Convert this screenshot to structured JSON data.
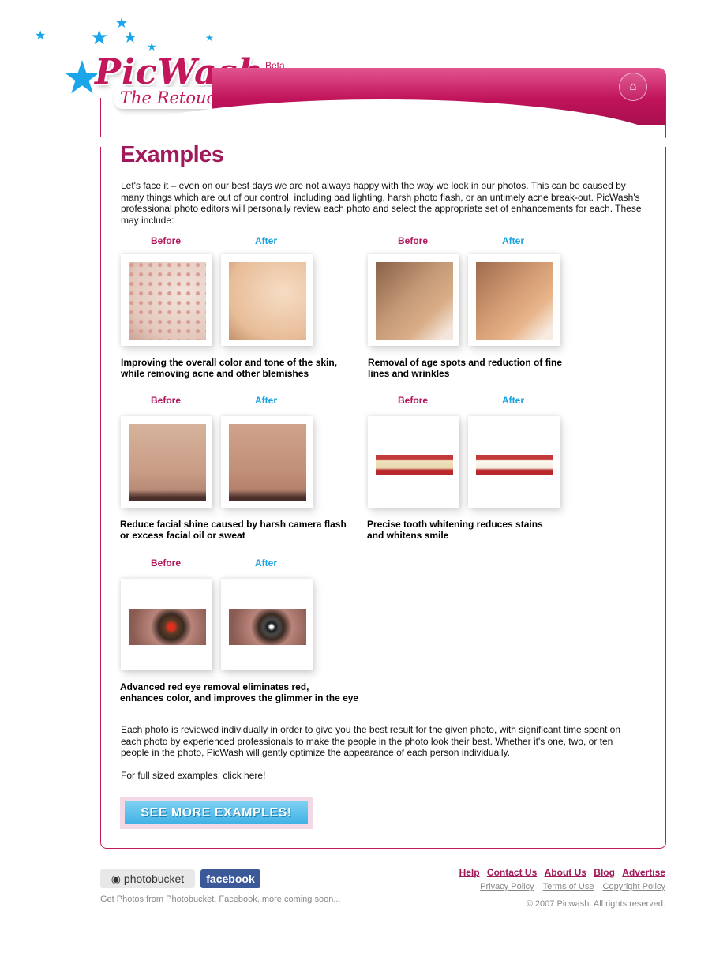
{
  "logo": {
    "name": "PicWash",
    "beta": "Beta",
    "tagline": "The Retouching Revolution"
  },
  "header": {
    "home_icon": "home-icon"
  },
  "page": {
    "title": "Examples",
    "intro": "Let's face it – even on our best days we are not always happy with the way we look in our photos. This can be caused by many things which are out of our control, including bad lighting, harsh photo flash, or an untimely acne break-out. PicWash's professional photo editors will personally review each photo and select the appropriate set of enhancements for each. These may include:",
    "examples": [
      {
        "before": "Before",
        "after": "After",
        "caption_line1": "Improving the overall color and tone of the skin,",
        "caption_line2": "while removing acne and other blemishes"
      },
      {
        "before": "Before",
        "after": "After",
        "caption_line1": "Removal of age spots and reduction of fine",
        "caption_line2": "lines and wrinkles"
      },
      {
        "before": "Before",
        "after": "After",
        "caption_line1": "Reduce facial shine caused by harsh camera flash",
        "caption_line2": "or excess facial oil or sweat"
      },
      {
        "before": "Before",
        "after": "After",
        "caption_line1": "Precise tooth whitening reduces stains",
        "caption_line2": "and whitens smile"
      },
      {
        "before": "Before",
        "after": "After",
        "caption_line1": "Advanced red eye removal eliminates red,",
        "caption_line2": "enhances color, and improves the glimmer in the eye"
      }
    ],
    "outro": "Each photo is reviewed individually in order to give you the best result for the given photo, with significant time spent on each photo by experienced professionals to make the people in the photo look their best. Whether it's one, two, or ten people in the photo, PicWash will gently optimize the appearance of each person individually.",
    "full_examples": "For full sized examples, click here!",
    "see_more": "SEE MORE EXAMPLES!"
  },
  "footer": {
    "photobucket": "photobucket",
    "facebook": "facebook",
    "note": "Get Photos from Photobucket, Facebook, more coming soon...",
    "links": [
      "Help",
      "Contact Us",
      "About Us",
      "Blog",
      "Advertise"
    ],
    "sublinks": [
      "Privacy Policy",
      "Terms of Use",
      "Copyright Policy"
    ],
    "copyright": "© 2007 Picwash. All rights reserved."
  },
  "colors": {
    "brand": "#c2185b",
    "accent": "#1aa3e0"
  }
}
